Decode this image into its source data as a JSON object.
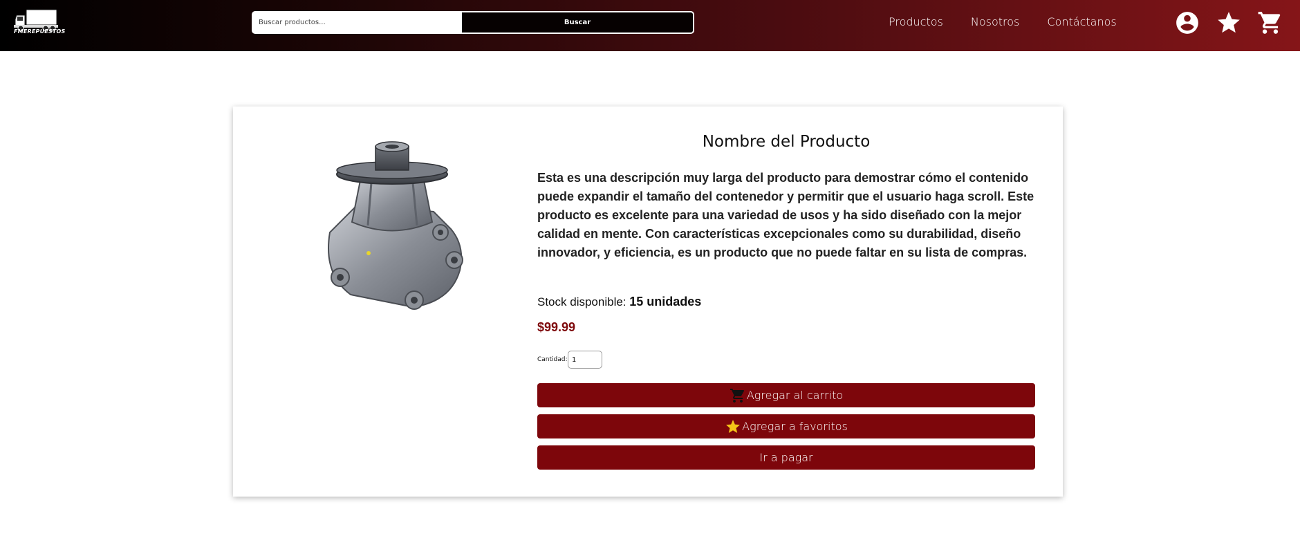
{
  "header": {
    "logo_text": "FMEREPUESTOS",
    "search": {
      "placeholder": "Buscar productos...",
      "button_label": "Buscar"
    },
    "nav": [
      "Productos",
      "Nosotros",
      "Contáctanos"
    ],
    "icons": [
      "account-circle-icon",
      "star-icon",
      "shopping-cart-icon"
    ]
  },
  "product": {
    "title": "Nombre del Producto",
    "description": "Esta es una descripción muy larga del producto para demostrar cómo el contenido puede expandir el tamaño del contenedor y permitir que el usuario haga scroll. Este producto es excelente para una variedad de usos y ha sido diseñado con la mejor calidad en mente. Con características excepcionales como su durabilidad, diseño innovador, y eficiencia, es un producto que no puede faltar en su lista de compras.",
    "stock_label": "Stock disponible:",
    "stock_value": "15 unidades",
    "price": "$99.99",
    "quantity_label": "Cantidad:",
    "quantity_value": "1",
    "image_icon": "water-pump-image"
  },
  "actions": {
    "add_to_cart": "Agregar al carrito",
    "add_to_favorites": "Agregar a favoritos",
    "checkout": "Ir a pagar"
  },
  "colors": {
    "accent": "#7d060b",
    "price": "#7f0a0d",
    "star": "#f5c518"
  }
}
